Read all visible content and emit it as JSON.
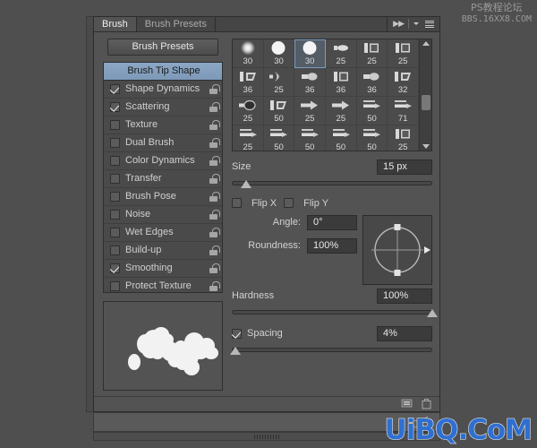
{
  "watermarks": {
    "top_line1": "PS教程论坛",
    "top_line2": "BBS.16XX8.COM",
    "bottom": "UiBQ.CoM"
  },
  "panel": {
    "tabs": [
      {
        "label": "Brush",
        "active": true
      },
      {
        "label": "Brush Presets",
        "active": false
      }
    ],
    "collapse_icon": "double-right-arrow-icon",
    "menu_icon": "panel-menu-icon",
    "presets_button": "Brush Presets"
  },
  "options_list": {
    "header": "Brush Tip Shape",
    "items": [
      {
        "label": "Shape Dynamics",
        "checked": true,
        "locked": true
      },
      {
        "label": "Scattering",
        "checked": true,
        "locked": true
      },
      {
        "label": "Texture",
        "checked": false,
        "locked": true
      },
      {
        "label": "Dual Brush",
        "checked": false,
        "locked": true
      },
      {
        "label": "Color Dynamics",
        "checked": false,
        "locked": true
      },
      {
        "label": "Transfer",
        "checked": false,
        "locked": true
      },
      {
        "label": "Brush Pose",
        "checked": false,
        "locked": true
      },
      {
        "label": "Noise",
        "checked": false,
        "locked": true
      },
      {
        "label": "Wet Edges",
        "checked": false,
        "locked": true
      },
      {
        "label": "Build-up",
        "checked": false,
        "locked": true
      },
      {
        "label": "Smoothing",
        "checked": true,
        "locked": true
      },
      {
        "label": "Protect Texture",
        "checked": false,
        "locked": true
      }
    ]
  },
  "brush_grid": {
    "selected_index": 2,
    "cells": [
      {
        "size": "30",
        "glyph": "soft-round"
      },
      {
        "size": "30",
        "glyph": "hard-round"
      },
      {
        "size": "30",
        "glyph": "hard-round"
      },
      {
        "size": "25",
        "glyph": "flat-tip"
      },
      {
        "size": "25",
        "glyph": "square-tip"
      },
      {
        "size": "25",
        "glyph": "square-tip"
      },
      {
        "size": "36",
        "glyph": "angled-tip"
      },
      {
        "size": "25",
        "glyph": "fan-tip"
      },
      {
        "size": "36",
        "glyph": "round-point"
      },
      {
        "size": "36",
        "glyph": "square-tip"
      },
      {
        "size": "36",
        "glyph": "round-point"
      },
      {
        "size": "32",
        "glyph": "angled-tip"
      },
      {
        "size": "25",
        "glyph": "round-blob"
      },
      {
        "size": "50",
        "glyph": "angled-tip"
      },
      {
        "size": "25",
        "glyph": "arrow-tip"
      },
      {
        "size": "25",
        "glyph": "arrow-tip"
      },
      {
        "size": "50",
        "glyph": "thin-tip"
      },
      {
        "size": "71",
        "glyph": "thin-tip"
      },
      {
        "size": "25",
        "glyph": "thin-tip"
      },
      {
        "size": "50",
        "glyph": "thin-tip"
      },
      {
        "size": "50",
        "glyph": "thin-tip"
      },
      {
        "size": "50",
        "glyph": "thin-tip"
      },
      {
        "size": "50",
        "glyph": "thin-tip"
      },
      {
        "size": "25",
        "glyph": "square-tip"
      }
    ],
    "scroll_up_icon": "scroll-up-arrow-icon",
    "scroll_down_icon": "scroll-down-arrow-icon"
  },
  "controls": {
    "size_label": "Size",
    "size_value": "15 px",
    "size_percent": 7,
    "flip_x_label": "Flip X",
    "flip_x_checked": false,
    "flip_y_label": "Flip Y",
    "flip_y_checked": false,
    "angle_label": "Angle:",
    "angle_value": "0°",
    "roundness_label": "Roundness:",
    "roundness_value": "100%",
    "hardness_label": "Hardness",
    "hardness_value": "100%",
    "hardness_percent": 100,
    "spacing_label": "Spacing",
    "spacing_checked": true,
    "spacing_value": "4%",
    "spacing_percent": 2
  },
  "footer": {
    "brush_tool_icon": "brush-tool-icon",
    "new_brush_icon": "new-brush-icon",
    "trash_icon": "delete-brush-icon"
  }
}
